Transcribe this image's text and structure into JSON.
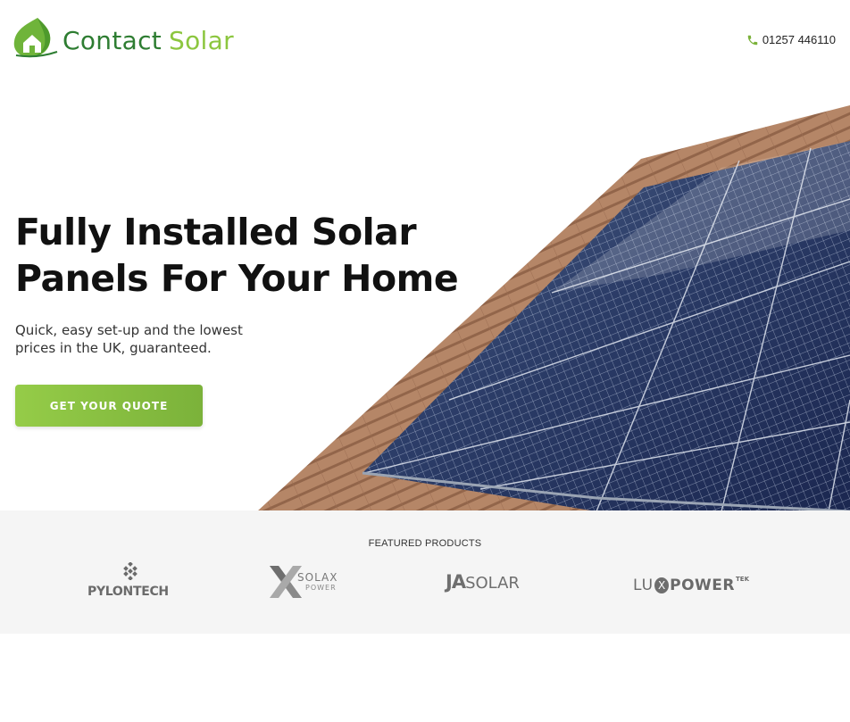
{
  "header": {
    "logo": {
      "word1": "Contact",
      "word2": "Solar",
      "icon": "leaf-house-icon"
    },
    "phone": {
      "icon": "phone-icon",
      "number": "01257 446110"
    }
  },
  "hero": {
    "title_line1": "Fully Installed Solar",
    "title_line2": "Panels For Your Home",
    "subtitle": "Quick, easy set-up and the lowest prices in the UK, guaranteed.",
    "cta_label": "GET YOUR QUOTE",
    "image": "solar-panels-on-roof"
  },
  "featured": {
    "title": "FEATURED PRODUCTS",
    "brands": {
      "pylontech": "PYLONTECH",
      "solax_name": "SOLAX",
      "solax_power": "POWER",
      "ja_bold": "JA",
      "ja_light": "SOLAR",
      "lux_a": "LU",
      "lux_x": "X",
      "lux_b": "POWER",
      "lux_tek": "TEK"
    }
  },
  "colors": {
    "brand_dark_green": "#2e7d32",
    "brand_light_green": "#8cc63f",
    "cta_green": "#8cc63f",
    "featured_bg": "#f5f5f5"
  }
}
